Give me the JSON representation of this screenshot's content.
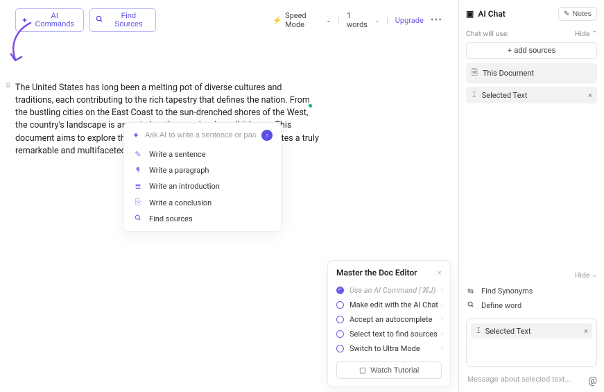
{
  "toolbar": {
    "ai_commands": "AI Commands",
    "find_sources": "Find Sources",
    "speed_mode": "Speed Mode",
    "word_count": "1 words",
    "upgrade": "Upgrade"
  },
  "paragraph": "The United States has long been a melting pot of diverse cultures and traditions, each contributing to the rich tapestry that defines the nation. From the bustling cities on the East Coast to the sun-drenched shores of the West, the country's landscape is as varied as the people who call it home. This document aims to explore the unique facets that make the United States a truly remarkable and multifaceted country.",
  "ai_popup": {
    "placeholder": "Ask AI to write a sentence or paragraph.",
    "items": [
      "Write a sentence",
      "Write a paragraph",
      "Write an introduction",
      "Write a conclusion",
      "Find sources"
    ]
  },
  "tutorial": {
    "title": "Master the Doc Editor",
    "items": [
      {
        "label": "Use an AI Command (⌘J)",
        "done": true
      },
      {
        "label": "Make edit with the AI Chat",
        "done": false
      },
      {
        "label": "Accept an autocomplete",
        "done": false
      },
      {
        "label": "Select text to find sources",
        "done": false
      },
      {
        "label": "Switch to Ultra Mode",
        "done": false
      }
    ],
    "watch": "Watch Tutorial"
  },
  "sidebar": {
    "title": "AI Chat",
    "notes": "Notes",
    "chat_will_use": "Chat will use:",
    "hide": "Hide",
    "add_sources": "+ add sources",
    "chips": {
      "this_doc": "This Document",
      "selected_text": "Selected Text"
    },
    "tools": {
      "find_synonyms": "Find Synonyms",
      "define_word": "Define word"
    },
    "message_placeholder": "Message about selected text..."
  }
}
